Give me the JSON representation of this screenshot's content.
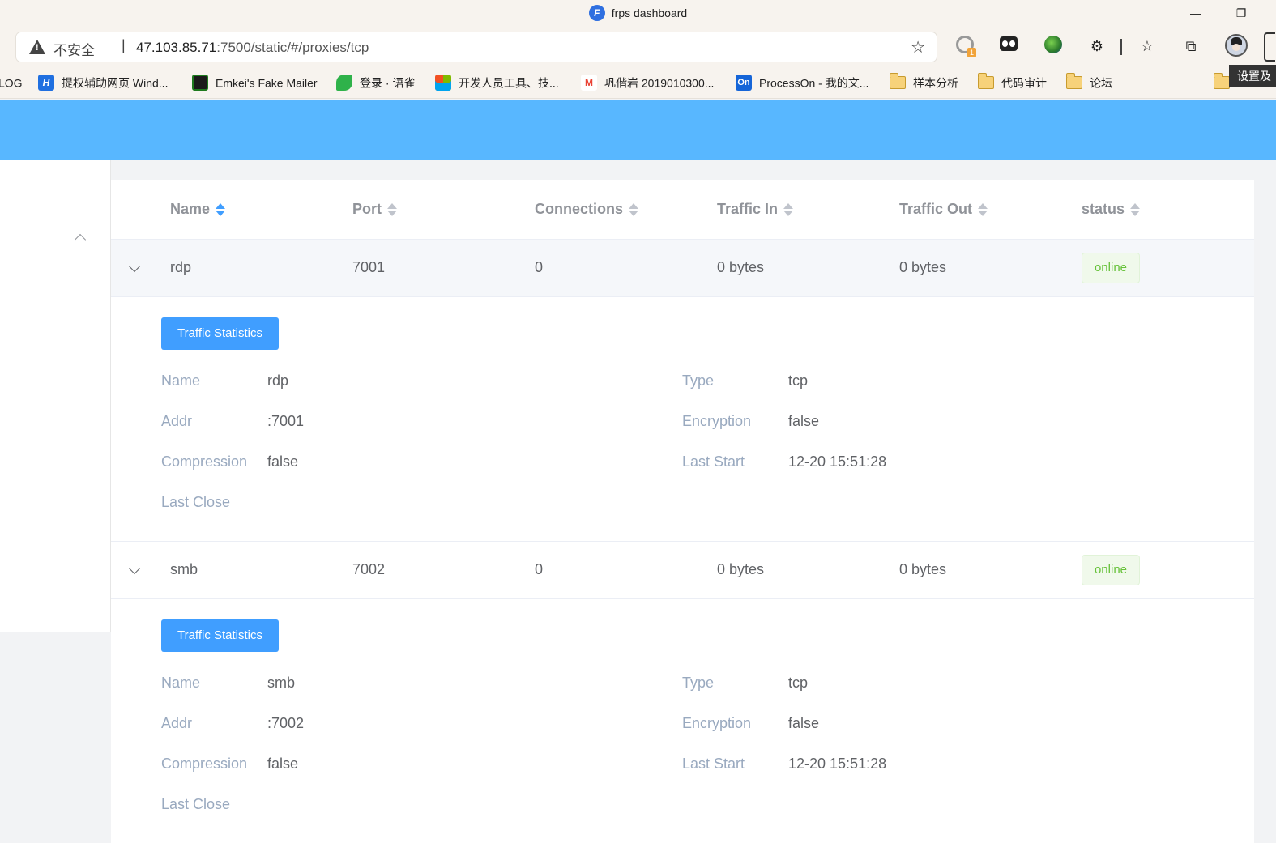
{
  "browser": {
    "tab_title": "frps dashboard",
    "address": {
      "security_label": "不安全",
      "host": "47.103.85.71",
      "path": ":7500/static/#/proxies/tcp"
    },
    "tooltip": "设置及",
    "bookmarks": [
      {
        "label": "LOG"
      },
      {
        "label": "提权辅助网页 Wind...",
        "icon": "H",
        "color": "#1f6fe0"
      },
      {
        "label": "Emkei's Fake Mailer",
        "color": "#1e7a1e"
      },
      {
        "label": "登录 · 语雀",
        "color": "#2fb24a"
      },
      {
        "label": "开发人员工具、技...",
        "color": "#f25022"
      },
      {
        "label": "巩偕岩 2019010300...",
        "icon": "M",
        "color": "#ea4335"
      },
      {
        "label": "ProcessOn - 我的文...",
        "icon": "On",
        "color": "#1565d8"
      },
      {
        "label": "样本分析"
      },
      {
        "label": "代码审计"
      },
      {
        "label": "论坛"
      }
    ]
  },
  "table": {
    "columns": [
      "Name",
      "Port",
      "Connections",
      "Traffic In",
      "Traffic Out",
      "status"
    ],
    "rows": [
      {
        "name": "rdp",
        "port": "7001",
        "connections": "0",
        "traffic_in": "0 bytes",
        "traffic_out": "0 bytes",
        "status": "online"
      },
      {
        "name": "smb",
        "port": "7002",
        "connections": "0",
        "traffic_in": "0 bytes",
        "traffic_out": "0 bytes",
        "status": "online"
      }
    ]
  },
  "details": [
    {
      "button": "Traffic Statistics",
      "fields_left": [
        {
          "key": "Name",
          "value": "rdp"
        },
        {
          "key": "Addr",
          "value": ":7001"
        },
        {
          "key": "Compression",
          "value": "false"
        },
        {
          "key": "Last Close",
          "value": ""
        }
      ],
      "fields_right": [
        {
          "key": "Type",
          "value": "tcp"
        },
        {
          "key": "Encryption",
          "value": "false"
        },
        {
          "key": "Last Start",
          "value": "12-20 15:51:28"
        }
      ]
    },
    {
      "button": "Traffic Statistics",
      "fields_left": [
        {
          "key": "Name",
          "value": "smb"
        },
        {
          "key": "Addr",
          "value": ":7002"
        },
        {
          "key": "Compression",
          "value": "false"
        },
        {
          "key": "Last Close",
          "value": ""
        }
      ],
      "fields_right": [
        {
          "key": "Type",
          "value": "tcp"
        },
        {
          "key": "Encryption",
          "value": "false"
        },
        {
          "key": "Last Start",
          "value": "12-20 15:51:28"
        }
      ]
    }
  ],
  "colors": {
    "header": "#58b7ff",
    "primary": "#409eff",
    "success": "#67c23a"
  }
}
